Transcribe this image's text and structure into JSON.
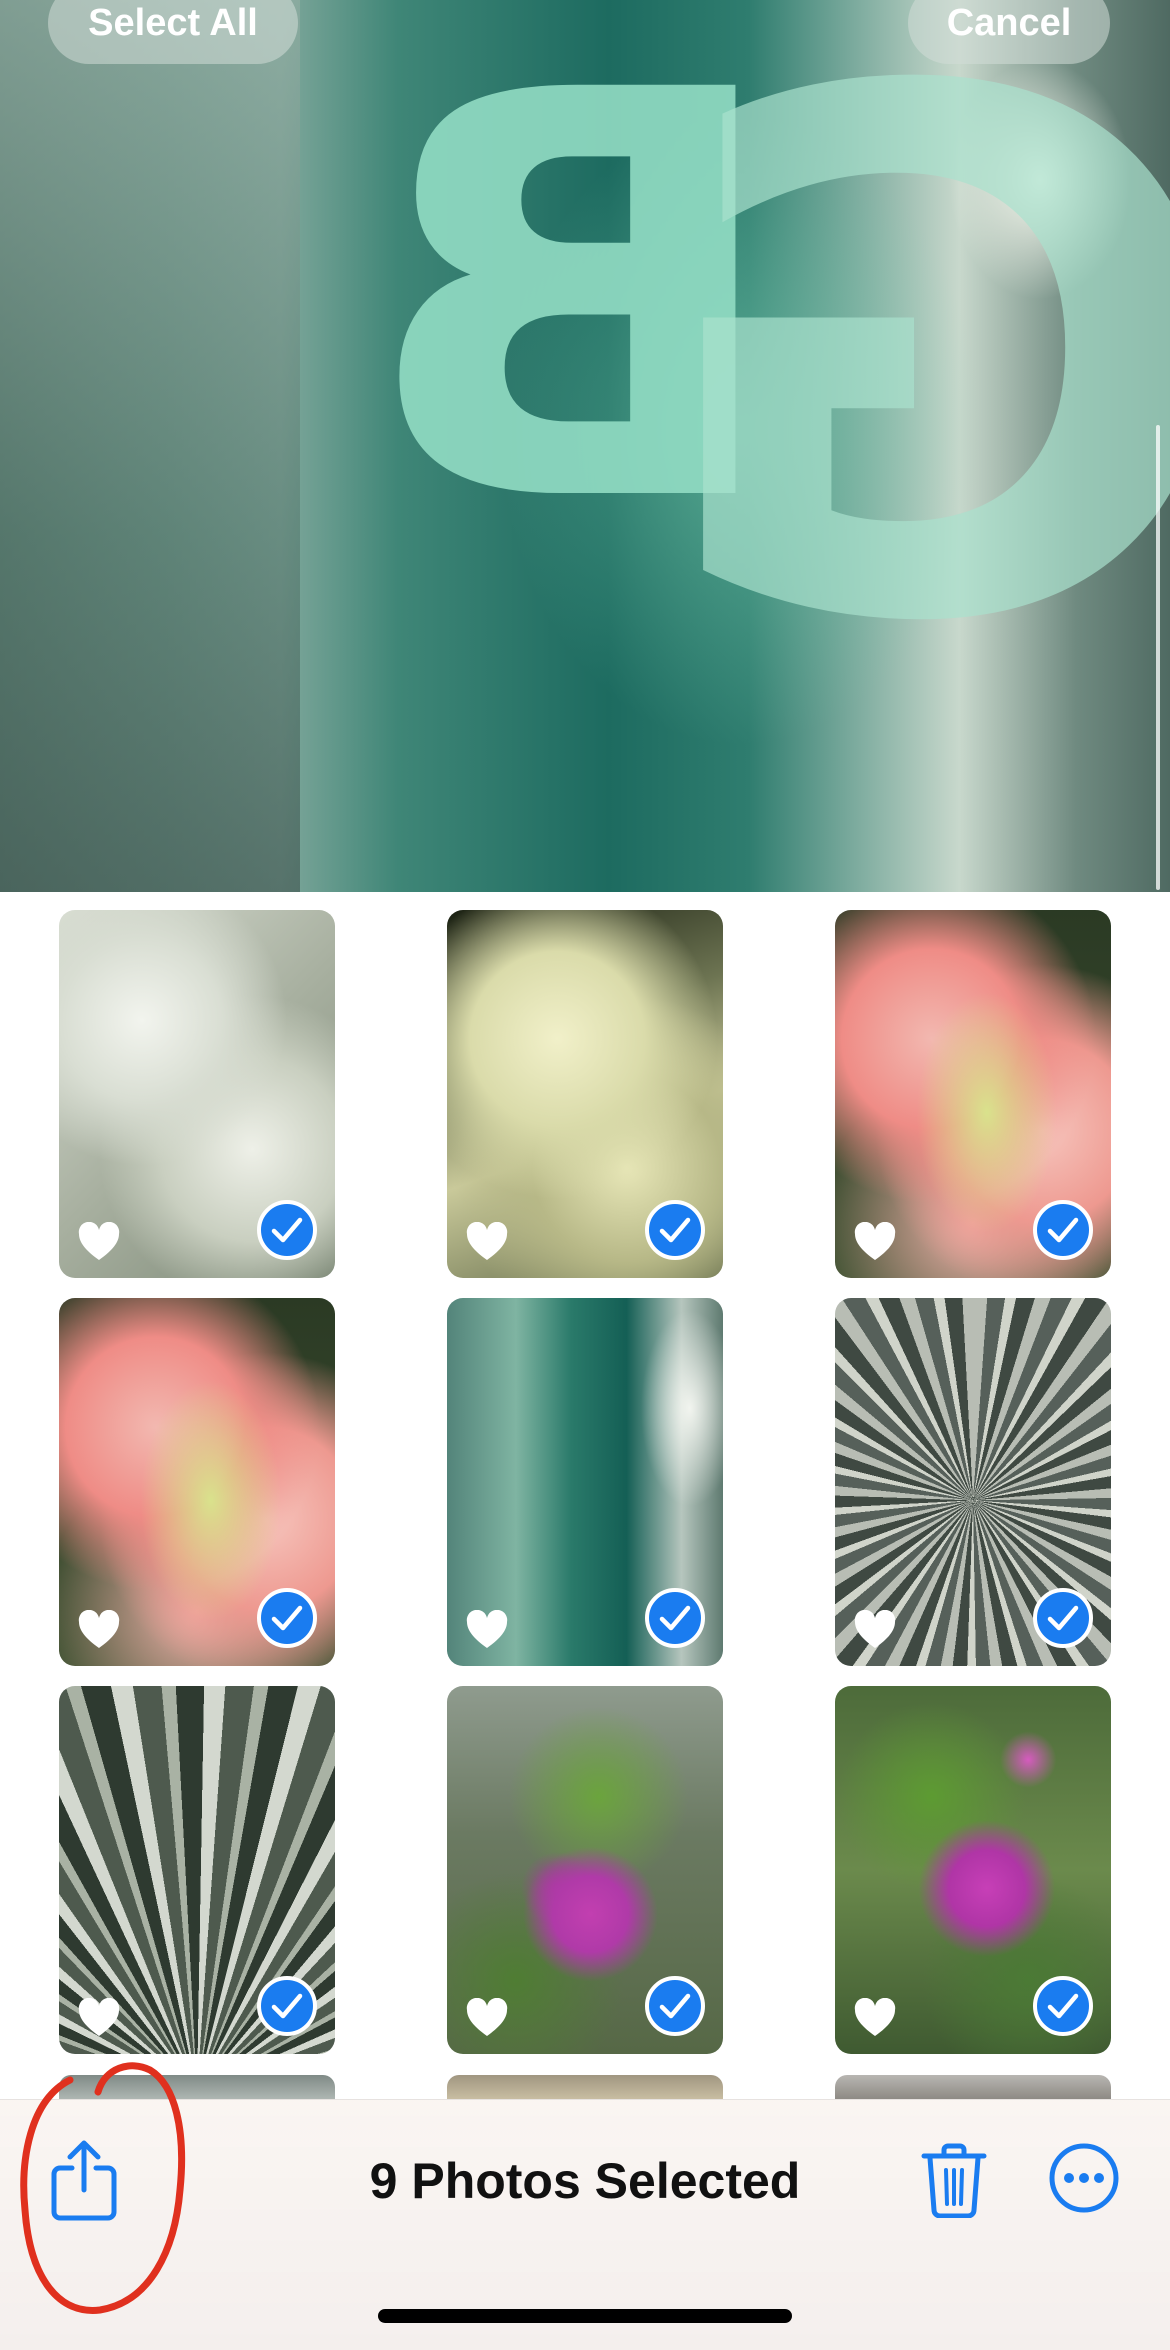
{
  "header": {
    "select_all_label": "Select All",
    "cancel_label": "Cancel"
  },
  "photos": [
    {
      "subject": "white poinsettia",
      "favorited": true,
      "selected": true
    },
    {
      "subject": "cream poinsettia",
      "favorited": true,
      "selected": true
    },
    {
      "subject": "pink amaryllis",
      "favorited": true,
      "selected": true
    },
    {
      "subject": "pink amaryllis",
      "favorited": true,
      "selected": true
    },
    {
      "subject": "green glass lettering",
      "favorited": true,
      "selected": true
    },
    {
      "subject": "spiky yucca",
      "favorited": true,
      "selected": true
    },
    {
      "subject": "fan palm leaves",
      "favorited": true,
      "selected": true
    },
    {
      "subject": "purple flowers",
      "favorited": true,
      "selected": true
    },
    {
      "subject": "purple flowers",
      "favorited": true,
      "selected": true
    }
  ],
  "toolbar": {
    "selection_title": "9 Photos Selected",
    "icons": [
      "share-icon",
      "trash-icon",
      "more-icon"
    ]
  },
  "colors": {
    "accent": "#1a7cf0",
    "annotation": "#e0301e"
  }
}
